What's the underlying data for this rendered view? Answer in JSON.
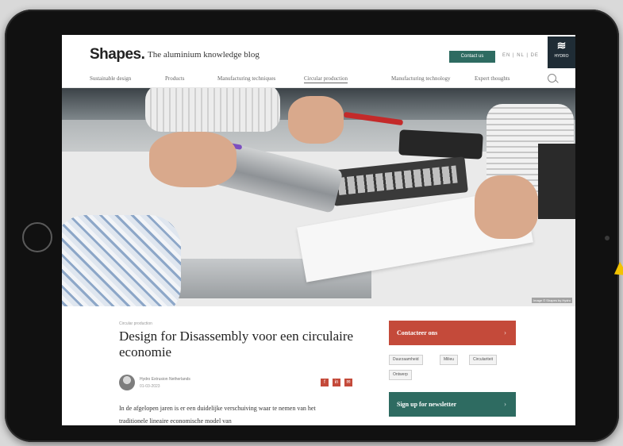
{
  "site": {
    "logo": "Shapes.",
    "tagline": "The aluminium knowledge blog",
    "contact_button": "Contact us",
    "languages": "EN | NL | DE",
    "brand": "HYDRO"
  },
  "nav": {
    "items": [
      {
        "label": "Sustainable design"
      },
      {
        "label": "Products"
      },
      {
        "label": "Manufacturing techniques"
      },
      {
        "label": "Circular production"
      },
      {
        "label": "Manufacturing technology"
      },
      {
        "label": "Expert thoughts"
      }
    ]
  },
  "hero": {
    "credit": "Image © Shapes by Hydro"
  },
  "article": {
    "kicker": "Circular production",
    "title": "Design for Disassembly voor een circulaire economie",
    "author_name": "Hydro Extrusion Netherlands",
    "author_date": "01-03-2023",
    "body": "In de afgelopen jaren is er een duidelijke verschuiving waar te nemen van het traditionele lineaire economische model van"
  },
  "sidebar": {
    "contact_label": "Contacteer ons",
    "tags": [
      "Duurzaamheid",
      "Milieu",
      "Circulariteit",
      "Ontwerp"
    ],
    "newsletter_label": "Sign up for newsletter",
    "chevron": "›"
  },
  "colors": {
    "accent_green": "#2e6b61",
    "accent_red": "#c44a3a",
    "brand_dark": "#1f2c35"
  }
}
